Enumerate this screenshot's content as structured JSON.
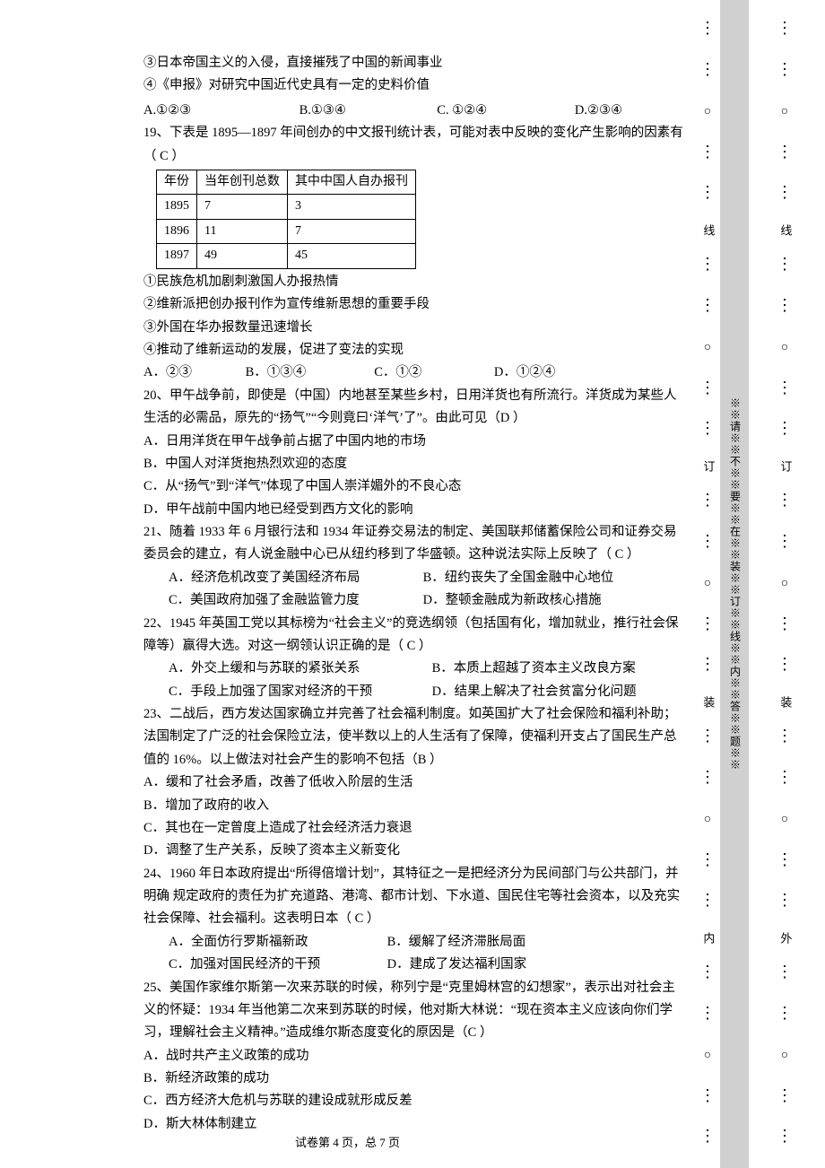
{
  "items34": {
    "l3": "③日本帝国主义的入侵，直接摧残了中国的新闻事业",
    "l4": "④《申报》对研究中国近代史具有一定的史料价值"
  },
  "q18opts": {
    "a": "A.①②③",
    "b": "B.①③④",
    "c": "C. ①②④",
    "d": "D.②③④"
  },
  "q19": {
    "stem": "19、下表是 1895—1897 年间创办的中文报刊统计表，可能对表中反映的变化产生影响的因素有（  C  ）",
    "table": {
      "head": [
        "年份",
        "当年创刊总数",
        "其中中国人自办报刊"
      ],
      "rows": [
        [
          "1895",
          "7",
          "3"
        ],
        [
          "1896",
          "11",
          "7"
        ],
        [
          "1897",
          "49",
          "45"
        ]
      ]
    },
    "i1": "①民族危机加剧刺激国人办报热情",
    "i2": "②维新派把创办报刊作为宣传维新思想的重要手段",
    "i3": "③外国在华办报数量迅速增长",
    "i4": "④推动了维新运动的发展，促进了变法的实现",
    "opts": {
      "a": "A．②③",
      "b": "B．①③④",
      "c": "C．①②",
      "d": "D．①②④"
    }
  },
  "q20": {
    "stem": "20、甲午战争前，即使是（中国）内地甚至某些乡村，日用洋货也有所流行。洋货成为某些人生活的必需品，原先的“扬气”“今则竟曰‘洋气’了”。由此可见（D     ）",
    "a": "A．日用洋货在甲午战争前占据了中国内地的市场",
    "b": "B．中国人对洋货抱热烈欢迎的态度",
    "c": "C．从“扬气”到“洋气”体现了中国人崇洋媚外的不良心态",
    "d": "D．甲午战前中国内地已经受到西方文化的影响"
  },
  "q21": {
    "stem": "21、随着 1933 年 6 月银行法和 1934 年证券交易法的制定、美国联邦储蓄保险公司和证券交易委员会的建立，有人说金融中心已从纽约移到了华盛顿。这种说法实际上反映了（  C  ）",
    "a": "A．经济危机改变了美国经济布局",
    "b": "B．纽约丧失了全国金融中心地位",
    "c": "C．美国政府加强了金融监管力度",
    "d": "D．整顿金融成为新政核心措施"
  },
  "q22": {
    "stem": "22、1945 年英国工党以其标榜为“社会主义”的竞选纲领（包括国有化，增加就业，推行社会保障等）赢得大选。对这一纲领认识正确的是（   C   ）",
    "a": "A．外交上缓和与苏联的紧张关系",
    "b": "B．本质上超越了资本主义改良方案",
    "c": "C．手段上加强了国家对经济的干预",
    "d": "D．结果上解决了社会贫富分化问题"
  },
  "q23": {
    "stem": "23、二战后，西方发达国家确立并完善了社会福利制度。如英国扩大了社会保险和福利补助；法国制定了广泛的社会保险立法，使半数以上的人生活有了保障，使福利开支占了国民生产总值的 16%。以上做法对社会产生的影响不包括（B    ）",
    "a": "A．缓和了社会矛盾，改善了低收入阶层的生活",
    "b": "B．增加了政府的收入",
    "c": "C．其也在一定曾度上造成了社会经济活力衰退",
    "d": "D．调整了生产关系，反映了资本主义新变化"
  },
  "q24": {
    "stem": "24、1960 年日本政府提出“所得倍增计划”，其特征之一是把经济分为民间部门与公共部门，并明确 规定政府的责任为扩充道路、港湾、都市计划、下水道、国民住宅等社会资本，以及充实社会保障、社会福利。这表明日本（   C   ）",
    "a": "A．全面仿行罗斯福新政",
    "b": "B．缓解了经济滞胀局面",
    "c": "C．加强对国民经济的干预",
    "d": "D．建成了发达福利国家"
  },
  "q25": {
    "stem": "25、美国作家维尔斯第一次来苏联的时候，称列宁是“克里姆林宫的幻想家”，表示出对社会主义的怀疑：1934 年当他第二次来到苏联的时候，他对斯大林说：“现在资本主义应该向你们学习，理解社会主义精神。”造成维尔斯态度变化的原因是（C    ）",
    "a": "A．战时共产主义政策的成功",
    "b": "B．新经济政策的成功",
    "c": "C．西方经济大危机与苏联的建设成就形成反差",
    "d": "D．斯大林体制建立"
  },
  "footer": "试卷第 4 页，总 7 页",
  "gutter": {
    "labels": [
      "线",
      "订",
      "装",
      "内",
      "外"
    ],
    "warn": "※※请※※不※※要※※在※※装※※订※※线※※内※※答※※题※※"
  },
  "chart_data": {
    "type": "table",
    "title": "1895—1897 年间创办的中文报刊统计表",
    "columns": [
      "年份",
      "当年创刊总数",
      "其中中国人自办报刊"
    ],
    "rows": [
      {
        "年份": 1895,
        "当年创刊总数": 7,
        "其中中国人自办报刊": 3
      },
      {
        "年份": 1896,
        "当年创刊总数": 11,
        "其中中国人自办报刊": 7
      },
      {
        "年份": 1897,
        "当年创刊总数": 49,
        "其中中国人自办报刊": 45
      }
    ]
  }
}
